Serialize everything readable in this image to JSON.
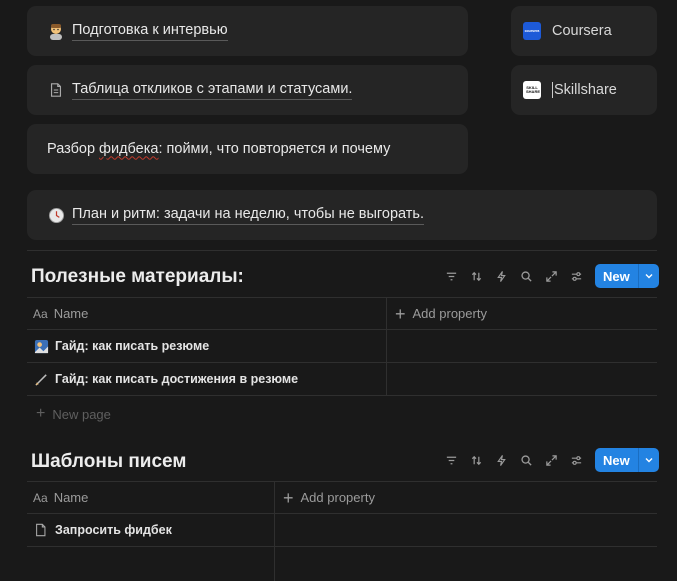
{
  "cards": {
    "interview_prep": "Подготовка к интервью",
    "responses_table": "Таблица откликов с этапами и статусами.",
    "feedback_analysis_prefix": "Разбор ",
    "feedback_analysis_word": "фидбека",
    "feedback_analysis_suffix": ": пойми, что повторяется и почему",
    "plan_rhythm": "План и ритм: задачи на неделю, чтобы не выгорать."
  },
  "side": {
    "coursera": "Coursera",
    "skillshare": "Skillshare",
    "coursera_logo_text": "coursera",
    "skillshare_logo_text": "SKILL SHARE"
  },
  "materials": {
    "title": "Полезные материалы:",
    "new_label": "New",
    "name_header": "Name",
    "name_header_icon": "Aa",
    "add_property": "Add property",
    "rows": [
      "Гайд: как писать резюме",
      "Гайд: как писать достижения в резюме"
    ],
    "new_page": "New page"
  },
  "templates": {
    "title": "Шаблоны писем",
    "new_label": "New",
    "name_header": "Name",
    "name_header_icon": "Aa",
    "add_property": "Add property",
    "rows": [
      "Запросить фидбек"
    ]
  },
  "colors": {
    "background": "#191919",
    "card": "#252525",
    "accent": "#2383e2"
  }
}
